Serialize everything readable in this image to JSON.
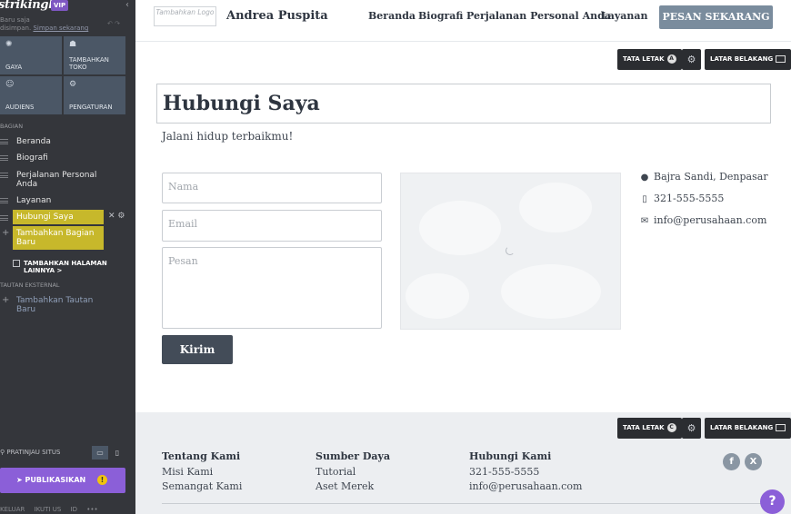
{
  "sidebar": {
    "brand": "strikingly",
    "badge": "VIP",
    "saved_line1": "Baru saja",
    "saved_line2_prefix": "disimpan.",
    "saved_link": "Simpan sekarang",
    "tiles": [
      {
        "label": "GAYA",
        "icon": "palette-icon"
      },
      {
        "label": "TAMBAHKAN TOKO",
        "icon": "store-icon"
      },
      {
        "label": "AUDIENS",
        "icon": "people-icon"
      },
      {
        "label": "PENGATURAN",
        "icon": "gear-icon"
      }
    ],
    "sections_heading": "BAGIAN",
    "sections": [
      "Beranda",
      "Biografi",
      "Perjalanan Personal Anda",
      "Layanan",
      "Hubungi Saya"
    ],
    "add_section": "Tambahkan Bagian Baru",
    "more_pages": "TAMBAHKAN HALAMAN LAINNYA >",
    "external_heading": "TAUTAN EKSTERNAL",
    "add_external": "Tambahkan Tautan Baru",
    "preview": "PRATINJAU SITUS",
    "publish": "PUBLIKASIKAN",
    "publish_warning": "!",
    "bottom": [
      "KELUAR",
      "IKUTI US",
      "ID",
      "•••"
    ]
  },
  "topnav": {
    "logo_placeholder": "Tambahkan Logo",
    "site_name": "Andrea Puspita",
    "items": [
      "Beranda",
      "Biografi",
      "Perjalanan Personal Anda",
      "Layanan"
    ],
    "cta": "PESAN SEKARANG"
  },
  "editor": {
    "layout_label": "TATA LETAK",
    "layout_variant_top": "A",
    "layout_variant_footer": "C",
    "background_label": "LATAR BELAKANG"
  },
  "contact": {
    "title": "Hubungi Saya",
    "subtitle": "Jalani hidup terbaikmu!",
    "name_placeholder": "Nama",
    "email_placeholder": "Email",
    "message_placeholder": "Pesan",
    "submit": "Kirim",
    "address": "Bajra Sandi, Denpasar",
    "phone": "321-555-5555",
    "email": "info@perusahaan.com"
  },
  "footer": {
    "columns": [
      {
        "heading": "Tentang Kami",
        "links": [
          "Misi Kami",
          "Semangat Kami"
        ]
      },
      {
        "heading": "Sumber Daya",
        "links": [
          "Tutorial",
          "Aset Merek"
        ]
      },
      {
        "heading": "Hubungi Kami",
        "links": [
          "321-555-5555",
          "info@perusahaan.com"
        ]
      }
    ],
    "social": [
      {
        "name": "facebook-icon",
        "glyph": "f"
      },
      {
        "name": "x-icon",
        "glyph": "X"
      }
    ]
  },
  "help": "?"
}
